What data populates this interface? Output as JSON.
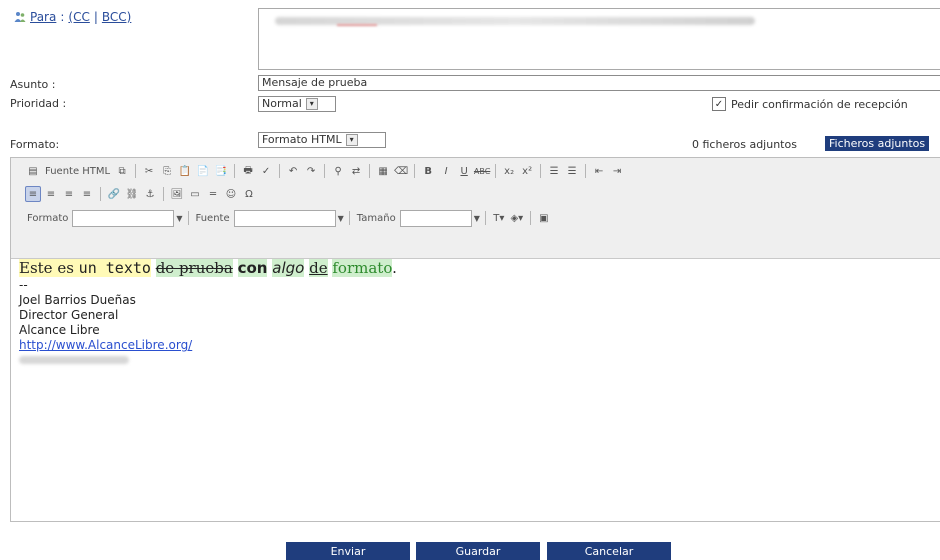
{
  "header": {
    "para_label": "Para",
    "colon": ":",
    "cc_open": "(CC",
    "separator": "|",
    "bcc_close": "BCC)"
  },
  "fields": {
    "asunto_label": "Asunto :",
    "asunto_value": "Mensaje de prueba",
    "prioridad_label": "Prioridad :",
    "prioridad_value": "Normal",
    "formato_label": "Formato:",
    "formato_value": "Formato HTML",
    "receipt_label": "Pedir confirmación de recepción",
    "attachments_count": "0 ficheros adjuntos",
    "attachments_button": "Ficheros adjuntos"
  },
  "editor": {
    "fuente_html": "Fuente HTML",
    "formato_label": "Formato",
    "fuente_label": "Fuente",
    "tamano_label": "Tamaño",
    "bold_glyph": "B",
    "italic_glyph": "I",
    "underline_glyph": "U",
    "strike_glyph": "ABC"
  },
  "body": {
    "seg1": "Este es ",
    "seg2": "un texto",
    "seg3": "de prueba",
    "seg4": "con",
    "seg5": "algo",
    "seg6": "de",
    "seg7": "formato",
    "seg8": ".",
    "dash": "--",
    "sig_name": "Joel Barrios Dueñas",
    "sig_title": "Director General",
    "sig_org": "Alcance Libre",
    "sig_link": "http://www.AlcanceLibre.org/"
  },
  "buttons": {
    "send": "Enviar",
    "save": "Guardar",
    "cancel": "Cancelar"
  }
}
